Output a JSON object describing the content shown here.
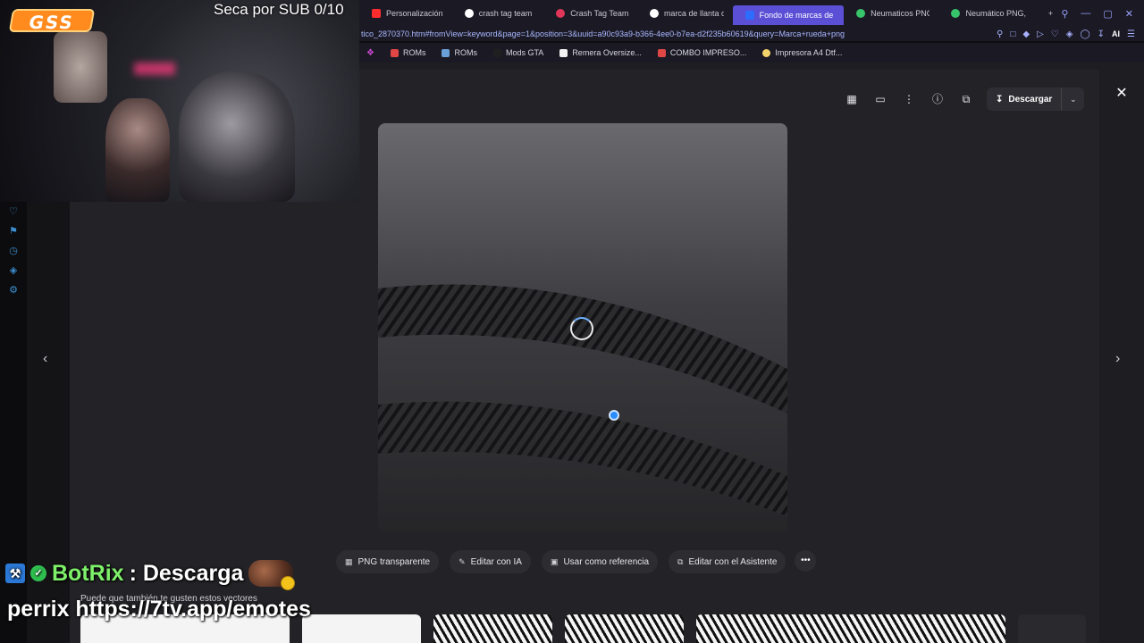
{
  "browser": {
    "tabs": [
      {
        "label": "Personalización del",
        "icon": "youtube-icon",
        "color": "#ff2d2d"
      },
      {
        "label": "crash tag team raci",
        "icon": "google-icon",
        "color": "#ffffff"
      },
      {
        "label": "Crash Tag Team Ra",
        "icon": "fandom-icon",
        "color": "#e0365a"
      },
      {
        "label": "marca de llanta de a",
        "icon": "google-icon",
        "color": "#ffffff"
      },
      {
        "label": "Fondo de marcas de impr",
        "icon": "freepik-icon",
        "color": "#2c6cff"
      },
      {
        "label": "Neumaticos PNG, D",
        "icon": "pngtree-icon",
        "color": "#37c46a"
      },
      {
        "label": "Neumático PNG, Dib",
        "icon": "pngtree-icon",
        "color": "#37c46a"
      }
    ],
    "new_tab_glyph": "+",
    "url": "tico_2870370.htm#fromView=keyword&page=1&position=3&uuid=a90c93a9-b366-4ee0-b7ea-d2f235b60619&query=Marca+rueda+png",
    "ai_label": "AI",
    "bookmarks": [
      {
        "label": "ROMs",
        "color": "#e04646"
      },
      {
        "label": "ROMs",
        "color": "#6aa0d8"
      },
      {
        "label": "Mods GTA",
        "color": "#1f1f1f"
      },
      {
        "label": "Remera Oversize...",
        "color": "#f2f2f2"
      },
      {
        "label": "COMBO IMPRESO...",
        "color": "#e04646"
      },
      {
        "label": "Impresora A4 Dtf...",
        "color": "#f3d36b"
      }
    ]
  },
  "viewer": {
    "download_label": "Descargar",
    "actions": [
      {
        "label": "PNG transparente",
        "icon": "transparent-icon"
      },
      {
        "label": "Editar con IA",
        "icon": "ai-edit-icon"
      },
      {
        "label": "Usar como referencia",
        "icon": "reference-icon"
      },
      {
        "label": "Editar con el Asistente",
        "icon": "assistant-edit-icon"
      }
    ],
    "more_glyph": "•••",
    "suggestions_title": "Puede que también te gusten estos vectores"
  },
  "overlay": {
    "logo_text": "GSS",
    "sub_goal": "Seca por SUB 0/10",
    "chat_user": "BotRix",
    "chat_message": ": Descarga",
    "chat_line2": "perrix https://7tv.app/emotes"
  }
}
